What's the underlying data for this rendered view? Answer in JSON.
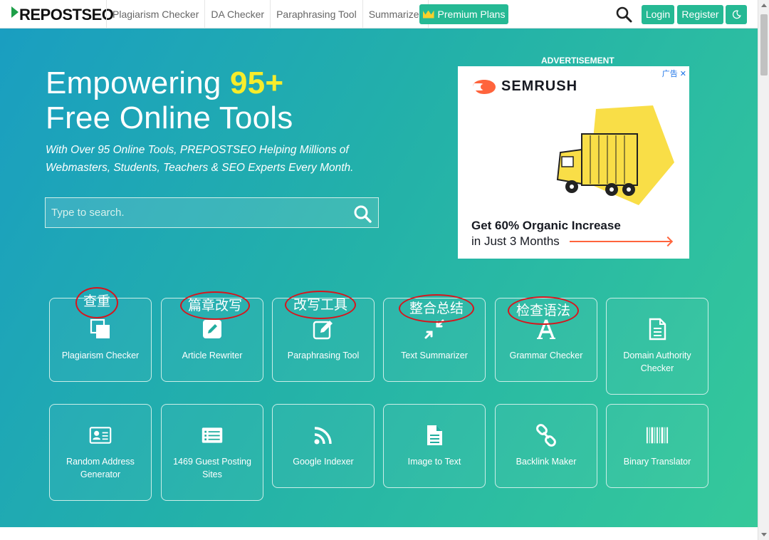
{
  "navbar": {
    "logo_text": "REPOSTSEO",
    "links": [
      "Plagiarism Checker",
      "DA Checker",
      "Paraphrasing Tool",
      "Summarizer"
    ],
    "premium_label": "Premium Plans",
    "login_label": "Login",
    "register_label": "Register",
    "icons": {
      "search": "search-icon",
      "dark_mode": "moon-icon",
      "premium": "crown-icon"
    }
  },
  "hero": {
    "headline_part1": "Empowering",
    "headline_highlight": "95+",
    "headline_part2": "Free Online Tools",
    "subline": "With Over 95 Online Tools, PREPOSTSEO Helping Millions of Webmasters, Students, Teachers & SEO Experts Every Month.",
    "search_placeholder": "Type to search.",
    "search_value": ""
  },
  "advertisement": {
    "label": "ADVERTISEMENT",
    "close_label": "广告 ✕",
    "brand": "SEMRUSH",
    "line1": "Get 60% Organic Increase",
    "line2": "in Just 3 Months"
  },
  "tools": [
    {
      "label": "Plagiarism Checker",
      "icon": "copy-icon"
    },
    {
      "label": "Article Rewriter",
      "icon": "edit-icon"
    },
    {
      "label": "Paraphrasing Tool",
      "icon": "pen-square-icon"
    },
    {
      "label": "Text Summarizer",
      "icon": "compress-icon"
    },
    {
      "label": "Grammar Checker",
      "icon": "letter-a-icon"
    },
    {
      "label": "Domain Authority Checker",
      "icon": "file-text-icon"
    },
    {
      "label": "Random Address Generator",
      "icon": "id-card-icon"
    },
    {
      "label": "1469 Guest Posting Sites",
      "icon": "list-icon"
    },
    {
      "label": "Google Indexer",
      "icon": "rss-icon"
    },
    {
      "label": "Image to Text",
      "icon": "file-lines-icon"
    },
    {
      "label": "Backlink Maker",
      "icon": "link-icon"
    },
    {
      "label": "Binary Translator",
      "icon": "barcode-icon"
    }
  ],
  "annotations": [
    "查重",
    "篇章改写",
    "改写工具",
    "整合总结",
    "检查语法"
  ],
  "colors": {
    "brand_green": "#25b994",
    "hero_start": "#1a9ec1",
    "hero_end": "#35c99a",
    "highlight_yellow": "#f7ec2b",
    "annotation_red": "#d8141c",
    "semrush_orange": "#ff643c"
  }
}
